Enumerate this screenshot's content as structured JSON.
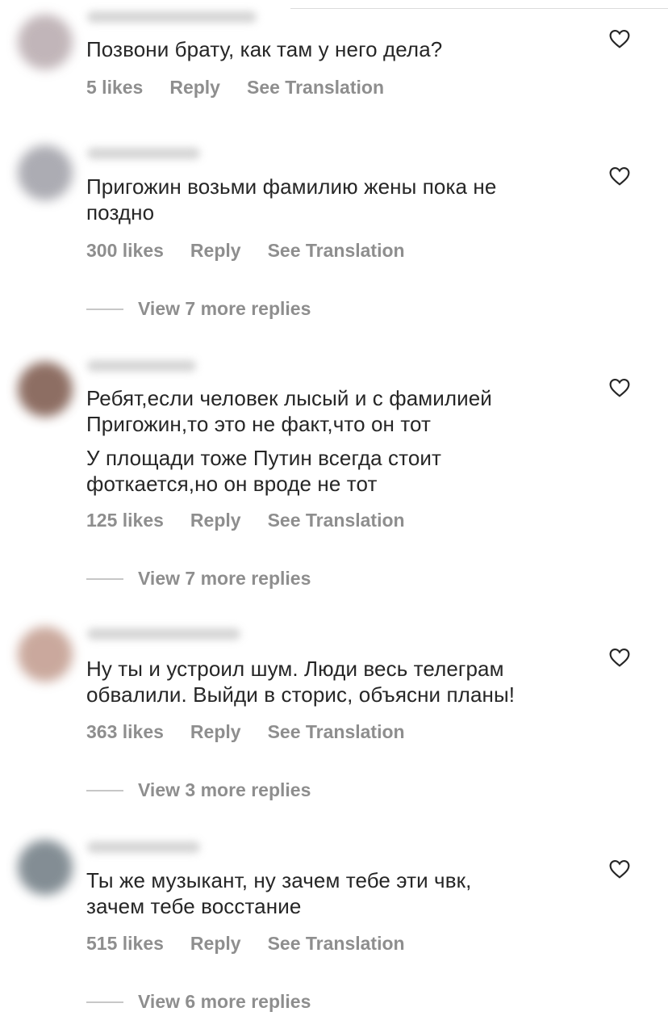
{
  "comments": [
    {
      "text_lines": [
        "Позвони брату, как там у него дела?"
      ],
      "likes": "5 likes",
      "reply": "Reply",
      "translate": "See Translation",
      "view_replies": null,
      "avatar_color": "#b7a9ad"
    },
    {
      "text_lines": [
        "Пригожин возьми фамилию жены пока не",
        "поздно"
      ],
      "likes": "300 likes",
      "reply": "Reply",
      "translate": "See Translation",
      "view_replies": "View 7 more replies",
      "avatar_color": "#9e9ea6"
    },
    {
      "text_lines": [
        "Ребят,если человек лысый и с фамилией",
        "Пригожин,то это не факт,что он тот",
        "У площади тоже Путин всегда стоит",
        "фоткается,но он вроде не тот"
      ],
      "likes": "125 likes",
      "reply": "Reply",
      "translate": "See Translation",
      "view_replies": "View 7 more replies",
      "avatar_color": "#7a5548"
    },
    {
      "text_lines": [
        "Ну ты и устроил шум. Люди весь телеграм",
        "обвалили. Выйди в сторис, объясни планы!"
      ],
      "likes": "363 likes",
      "reply": "Reply",
      "translate": "See Translation",
      "view_replies": "View 3 more replies",
      "avatar_color": "#c19a8c"
    },
    {
      "text_lines": [
        "Ты же музыкант, ну зачем тебе эти чвк,",
        "зачем тебе восстание"
      ],
      "likes": "515 likes",
      "reply": "Reply",
      "translate": "See Translation",
      "view_replies": "View 6 more replies",
      "avatar_color": "#6e7a82"
    }
  ],
  "icons": {
    "like": "heart-outline-icon"
  },
  "colors": {
    "text": "#262626",
    "secondary": "#8e8e8e",
    "divider": "#dbdbdb"
  }
}
